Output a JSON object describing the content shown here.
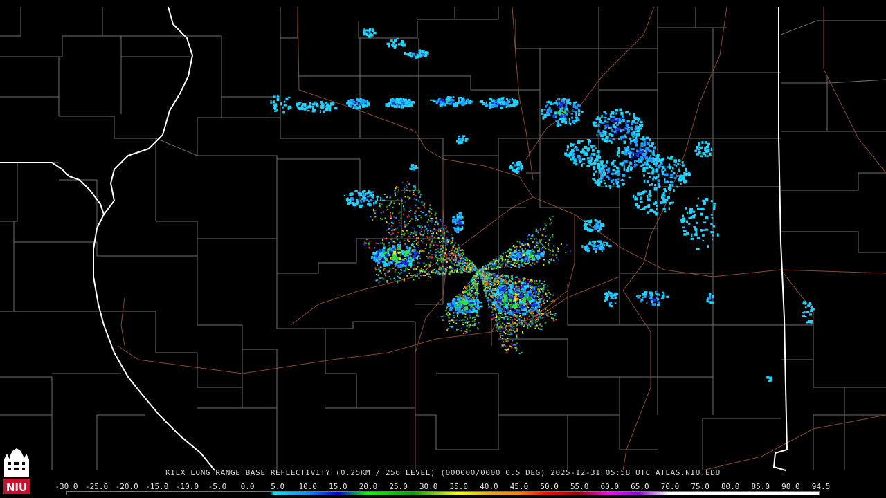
{
  "product": {
    "radar_id": "KILX",
    "caption": "KILX LONG RANGE BASE REFLECTIVITY (0.25KM / 256 LEVEL) (000000/0000 0.5 DEG) 2025-12-31 05:58 UTC  ATLAS.NIU.EDU"
  },
  "legend": {
    "values": [
      "-30.0",
      "-25.0",
      "-20.0",
      "-15.0",
      "-10.0",
      "-5.0",
      "0.0",
      "5.0",
      "10.0",
      "15.0",
      "20.0",
      "25.0",
      "30.0",
      "35.0",
      "40.0",
      "45.0",
      "50.0",
      "55.0",
      "60.0",
      "65.0",
      "70.0",
      "75.0",
      "80.0",
      "85.0",
      "90.0",
      "94.5"
    ],
    "colors": [
      "#000000",
      "#000000",
      "#000000",
      "#000000",
      "#000000",
      "#000000",
      "#00c8ff",
      "#0096ff",
      "#0000e6",
      "#00e600",
      "#00b400",
      "#008c00",
      "#ffff00",
      "#e6c800",
      "#ff9600",
      "#ff0000",
      "#c80000",
      "#a00000",
      "#ff00ff",
      "#a000e6",
      "#ffffff",
      "#ffffff",
      "#ffffff",
      "#ffffff",
      "#ffffff"
    ]
  },
  "map_colors": {
    "background": "#000000",
    "county_lines": "#6e6e6e",
    "state_lines": "#ffffff",
    "highways": "#8b4a2a"
  },
  "logo": {
    "text": "NIU",
    "color": "#c8102e"
  }
}
